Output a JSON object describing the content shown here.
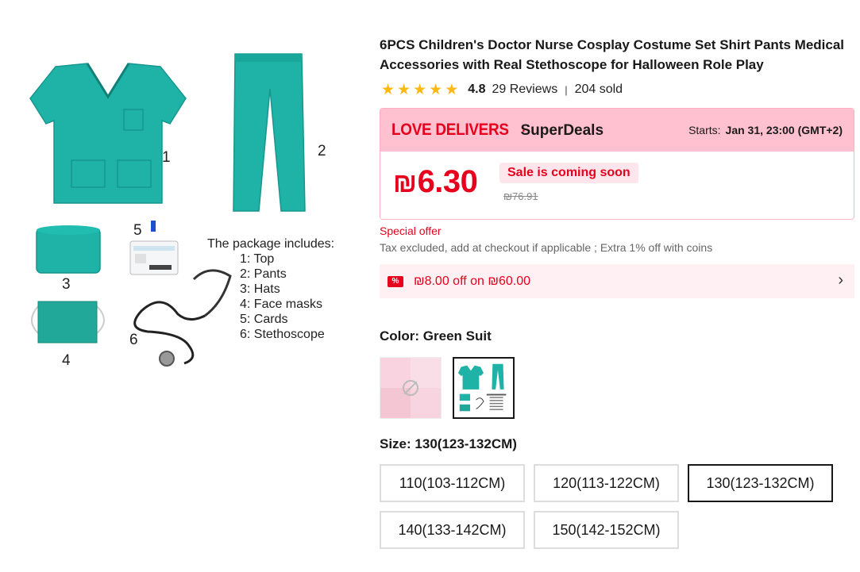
{
  "product": {
    "title": "6PCS Children's Doctor Nurse Cosplay Costume Set Shirt Pants Medical Accessories with Real Stethoscope for Halloween Role Play",
    "rating": "4.8",
    "reviews": "29 Reviews",
    "divider": "|",
    "sold": "204 sold",
    "stars": [
      "★",
      "★",
      "★",
      "★",
      "★"
    ]
  },
  "image": {
    "numbers": [
      "1",
      "2",
      "3",
      "4",
      "5",
      "6"
    ],
    "package_title": "The package includes:",
    "package_items": [
      "1: Top",
      "2: Pants",
      "3: Hats",
      "4: Face masks",
      "5: Cards",
      "6: Stethoscope"
    ]
  },
  "deal": {
    "brand_love": "LOVE DELIVERS",
    "brand_dot": "·",
    "brand_super": "SuperDeals",
    "starts_label": "Starts:",
    "starts_value": "Jan 31, 23:00 (GMT+2)",
    "currency": "₪",
    "price": "6.30",
    "coming_soon": "Sale is coming soon",
    "old_price": "₪76.91"
  },
  "offers": {
    "special": "Special offer",
    "tax": "Tax excluded, add at checkout if applicable ; Extra 1% off with coins",
    "coupon": "₪8.00 off on ₪60.00",
    "coupon_icon": "%",
    "chevron": "›"
  },
  "color": {
    "label": "Color:",
    "value": "Green Suit"
  },
  "size": {
    "label": "Size:",
    "value": "130(123-132CM)",
    "options": [
      "110(103-112CM)",
      "120(113-122CM)",
      "130(123-132CM)",
      "140(133-142CM)",
      "150(142-152CM)"
    ],
    "selected_index": 2
  },
  "colors": {
    "accent": "#e6001d",
    "teal": "#1fb3a8",
    "star": "#fdb913",
    "deal_bg": "#ffc0cf"
  }
}
